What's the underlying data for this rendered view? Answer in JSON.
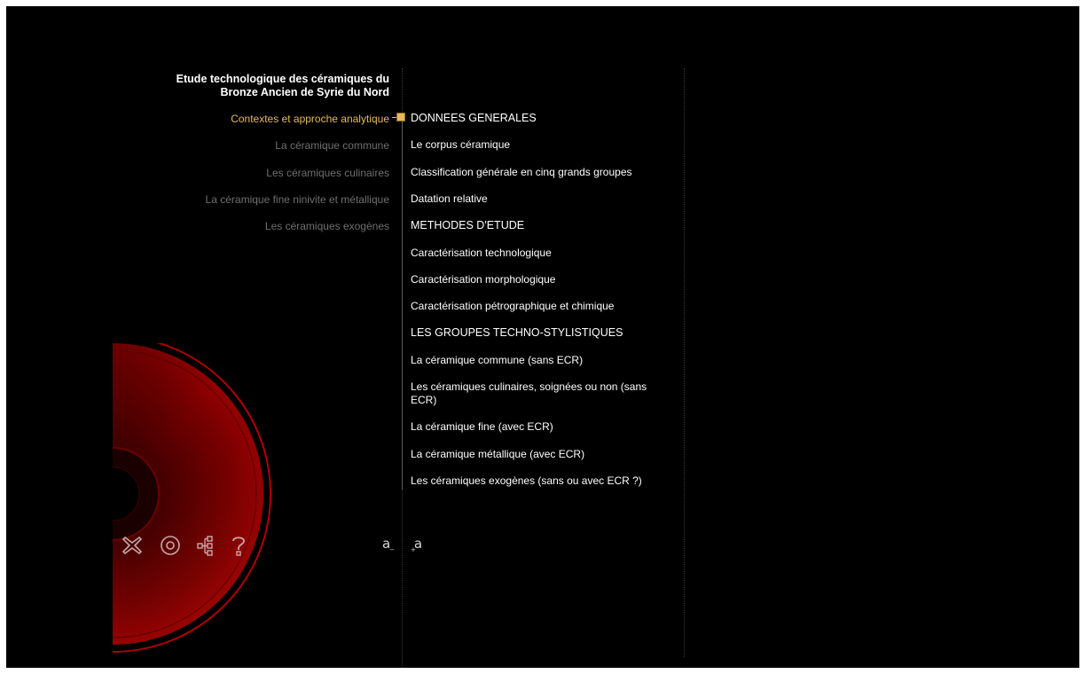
{
  "header": {
    "title": "Etude technologique des céramiques du Bronze Ancien de Syrie du Nord"
  },
  "left_nav": {
    "items": [
      {
        "label": "Contextes et approche analytique",
        "active": true
      },
      {
        "label": "La céramique commune",
        "active": false
      },
      {
        "label": "Les céramiques culinaires",
        "active": false
      },
      {
        "label": "La céramique fine ninivite et métallique",
        "active": false
      },
      {
        "label": "Les céramiques exogènes",
        "active": false
      }
    ]
  },
  "toc": {
    "items": [
      {
        "label": "DONNEES GENERALES",
        "section": true
      },
      {
        "label": "Le corpus céramique",
        "section": false
      },
      {
        "label": "Classification générale en cinq grands groupes",
        "section": false
      },
      {
        "label": "Datation relative",
        "section": false
      },
      {
        "label": "METHODES D'ETUDE",
        "section": true
      },
      {
        "label": "Caractérisation technologique",
        "section": false
      },
      {
        "label": "Caractérisation morphologique",
        "section": false
      },
      {
        "label": "Caractérisation pétrographique et chimique",
        "section": false
      },
      {
        "label": "LES GROUPES TECHNO-STYLISTIQUES",
        "section": true
      },
      {
        "label": "La céramique commune (sans ECR)",
        "section": false
      },
      {
        "label": "Les céramiques culinaires, soignées ou non (sans ECR)",
        "section": false
      },
      {
        "label": "La céramique fine (avec ECR)",
        "section": false
      },
      {
        "label": "La céramique métallique (avec ECR)",
        "section": false
      },
      {
        "label": "Les céramiques exogènes (sans ou avec ECR ?)",
        "section": false
      }
    ]
  },
  "toolbar": {
    "icons": [
      "close-icon",
      "home-icon",
      "sitemap-icon",
      "help-icon"
    ],
    "font_decrease": "a",
    "font_increase": "a"
  },
  "colors": {
    "background": "#000000",
    "accent": "#e6b95a",
    "inactive_text": "#6f6f6f",
    "disc_red": "#c00000"
  }
}
